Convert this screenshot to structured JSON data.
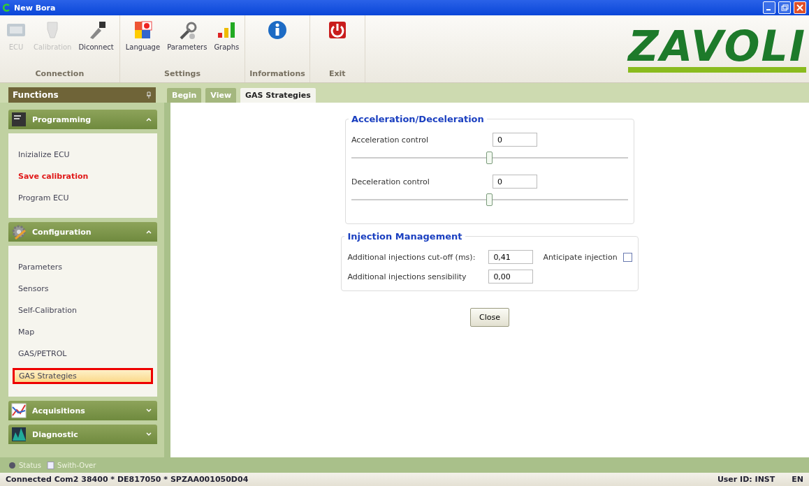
{
  "window": {
    "title": "New Bora"
  },
  "ribbon": {
    "groups": [
      {
        "label": "Connection",
        "items": [
          {
            "label": "ECU",
            "disabled": true
          },
          {
            "label": "Calibration",
            "disabled": true
          },
          {
            "label": "Diconnect",
            "disabled": false
          }
        ]
      },
      {
        "label": "Settings",
        "items": [
          {
            "label": "Language",
            "disabled": false
          },
          {
            "label": "Parameters",
            "disabled": false
          },
          {
            "label": "Graphs",
            "disabled": false
          }
        ]
      },
      {
        "label": "Informations",
        "items": [
          {
            "disabled": false
          }
        ]
      },
      {
        "label": "Exit",
        "items": [
          {
            "disabled": false
          }
        ]
      }
    ],
    "logo": "ZAVOLI"
  },
  "functions_panel": {
    "title": "Functions"
  },
  "tabs": [
    {
      "label": "Begin",
      "selected": false
    },
    {
      "label": "View",
      "selected": false
    },
    {
      "label": "GAS Strategies",
      "selected": true
    }
  ],
  "sidebar": {
    "sections": [
      {
        "title": "Programming",
        "expanded": true,
        "items": [
          {
            "label": "Inizialize ECU",
            "selected": false,
            "emphasis": false,
            "annotated": false
          },
          {
            "label": "Save calibration",
            "selected": false,
            "emphasis": true,
            "annotated": false
          },
          {
            "label": "Program ECU",
            "selected": false,
            "emphasis": false,
            "annotated": false
          }
        ]
      },
      {
        "title": "Configuration",
        "expanded": true,
        "items": [
          {
            "label": "Parameters",
            "selected": false,
            "emphasis": false,
            "annotated": false
          },
          {
            "label": "Sensors",
            "selected": false,
            "emphasis": false,
            "annotated": false
          },
          {
            "label": "Self-Calibration",
            "selected": false,
            "emphasis": false,
            "annotated": false
          },
          {
            "label": "Map",
            "selected": false,
            "emphasis": false,
            "annotated": false
          },
          {
            "label": "GAS/PETROL",
            "selected": false,
            "emphasis": false,
            "annotated": false
          },
          {
            "label": "GAS Strategies",
            "selected": true,
            "emphasis": false,
            "annotated": true
          }
        ]
      },
      {
        "title": "Acquisitions",
        "expanded": false
      },
      {
        "title": "Diagnostic",
        "expanded": false
      }
    ]
  },
  "form": {
    "groups": [
      {
        "title": "Acceleration/Deceleration",
        "rows": [
          {
            "kind": "slider",
            "label": "Acceleration control",
            "value": "0",
            "level": 0.5
          },
          {
            "kind": "slider",
            "label": "Deceleration control",
            "value": "0",
            "level": 0.5
          }
        ]
      },
      {
        "title": "Injection Management",
        "rows": [
          {
            "kind": "field",
            "label": "Additional injections cut-off (ms):",
            "value": "0,41",
            "check_label": "Anticipate injection",
            "checked": false
          },
          {
            "kind": "field",
            "label": "Additional injections sensibility",
            "value": "0,00"
          }
        ]
      }
    ],
    "close_button": "Close"
  },
  "bottom_tabs": [
    {
      "label": "Status"
    },
    {
      "label": "Swith-Over"
    }
  ],
  "status_bar": {
    "connection": "Connected Com2 38400 * DE817050 * SPZAA001050D04",
    "user": "User ID: INST",
    "language": "EN"
  }
}
